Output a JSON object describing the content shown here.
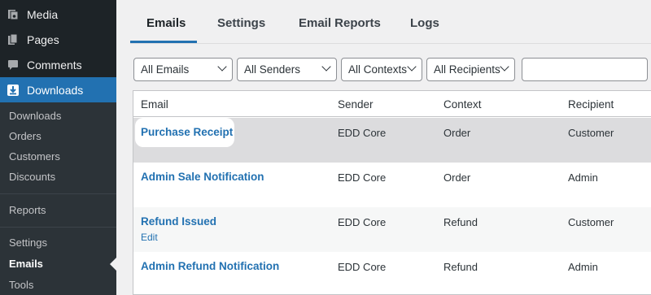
{
  "sidebar": {
    "menu": [
      {
        "label": "Media",
        "icon": "media-icon"
      },
      {
        "label": "Pages",
        "icon": "pages-icon"
      },
      {
        "label": "Comments",
        "icon": "comments-icon"
      },
      {
        "label": "Downloads",
        "icon": "downloads-icon",
        "active": true
      }
    ],
    "submenu": [
      {
        "label": "Downloads"
      },
      {
        "label": "Orders"
      },
      {
        "label": "Customers"
      },
      {
        "label": "Discounts"
      },
      {
        "label": "Reports"
      },
      {
        "label": "Settings"
      },
      {
        "label": "Emails",
        "current": true
      },
      {
        "label": "Tools"
      }
    ]
  },
  "tabs": [
    {
      "label": "Emails",
      "active": true
    },
    {
      "label": "Settings"
    },
    {
      "label": "Email Reports"
    },
    {
      "label": "Logs"
    }
  ],
  "filters": {
    "emails": "All Emails",
    "senders": "All Senders",
    "contexts": "All Contexts",
    "recipients": "All Recipients",
    "search_value": ""
  },
  "table": {
    "headers": {
      "email": "Email",
      "sender": "Sender",
      "context": "Context",
      "recipient": "Recipient"
    },
    "rows": [
      {
        "email": "Purchase Receipt",
        "sender": "EDD Core",
        "context": "Order",
        "recipient": "Customer"
      },
      {
        "email": "Admin Sale Notification",
        "sender": "EDD Core",
        "context": "Order",
        "recipient": "Admin"
      },
      {
        "email": "Refund Issued",
        "sender": "EDD Core",
        "context": "Refund",
        "recipient": "Customer",
        "action": "Edit"
      },
      {
        "email": "Admin Refund Notification",
        "sender": "EDD Core",
        "context": "Refund",
        "recipient": "Admin"
      }
    ]
  },
  "colors": {
    "accent": "#2271b1",
    "sidebar_bg": "#1d2327",
    "submenu_bg": "#2c3338"
  }
}
